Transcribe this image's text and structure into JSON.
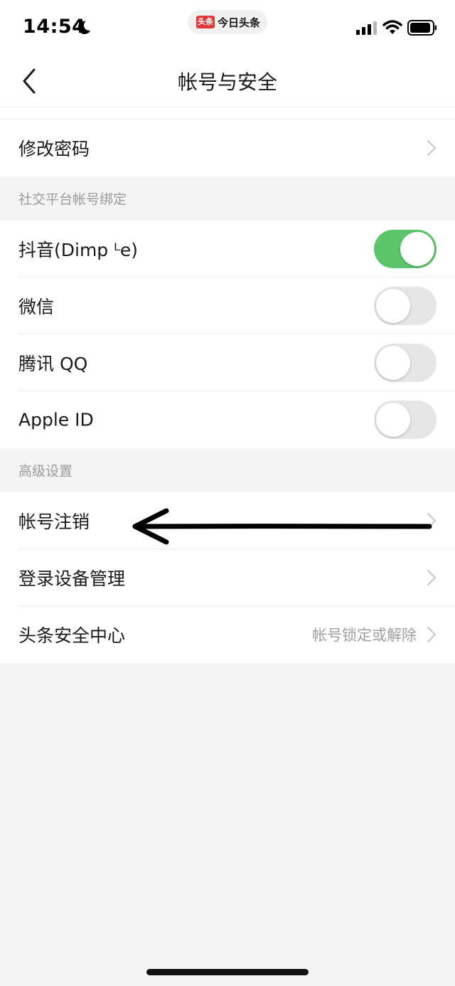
{
  "status_bar": {
    "time": "14:54",
    "app_badge": "头条",
    "app_name": "今日头条"
  },
  "nav": {
    "title": "帐号与安全"
  },
  "rows": {
    "change_password": {
      "label": "修改密码"
    },
    "douyin": {
      "label": "抖音(Dimp ᴸe)",
      "on": true
    },
    "wechat": {
      "label": "微信",
      "on": false
    },
    "qq": {
      "label": "腾讯 QQ",
      "on": false
    },
    "apple_id": {
      "label": "Apple ID",
      "on": false
    },
    "account_cancel": {
      "label": "帐号注销"
    },
    "device_manage": {
      "label": "登录设备管理"
    },
    "security_center": {
      "label": "头条安全中心",
      "value": "帐号锁定或解除"
    }
  },
  "sections": {
    "social": "社交平台帐号绑定",
    "advanced": "高级设置"
  },
  "colors": {
    "toggle_on": "#5cc56a",
    "toggle_off": "#e6e6e6",
    "brand_red": "#e5383b"
  }
}
